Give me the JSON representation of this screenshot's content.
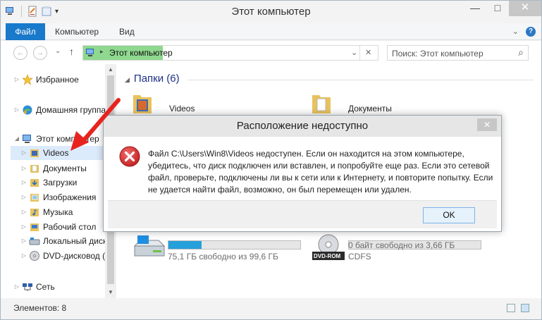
{
  "window": {
    "title": "Этот компьютер",
    "controls": {
      "minimize": "—",
      "maximize": "□",
      "close": "✕"
    }
  },
  "ribbon": {
    "tabs": [
      "Файл",
      "Компьютер",
      "Вид"
    ],
    "collapse_glyph": "⌄",
    "help_glyph": "?"
  },
  "navigation": {
    "back_glyph": "←",
    "forward_glyph": "→",
    "recent_glyph": "⌄",
    "up_glyph": "↑",
    "address_path": "Этот компьютер",
    "address_sep": "▸",
    "address_dropdown_glyph": "⌄",
    "address_clear_glyph": "✕",
    "search_placeholder": "Поиск: Этот компьютер",
    "search_icon_glyph": "⌕"
  },
  "nav_pane": {
    "items": [
      {
        "label": "Избранное",
        "icon": "star-icon"
      },
      {
        "label": "Домашняя группа",
        "icon": "homegroup-icon"
      },
      {
        "label": "Этот компьютер",
        "icon": "computer-icon"
      },
      {
        "label": "Videos",
        "icon": "videos-folder-icon"
      },
      {
        "label": "Документы",
        "icon": "documents-folder-icon"
      },
      {
        "label": "Загрузки",
        "icon": "downloads-folder-icon"
      },
      {
        "label": "Изображения",
        "icon": "pictures-folder-icon"
      },
      {
        "label": "Музыка",
        "icon": "music-folder-icon"
      },
      {
        "label": "Рабочий стол",
        "icon": "desktop-folder-icon"
      },
      {
        "label": "Локальный диск",
        "icon": "local-disk-icon"
      },
      {
        "label": "DVD-дисковод (E",
        "icon": "dvd-drive-icon"
      },
      {
        "label": "Сеть",
        "icon": "network-icon"
      }
    ]
  },
  "content": {
    "group_title": "Папки (6)",
    "folders": [
      {
        "name": "Videos",
        "icon": "videos-folder-icon"
      },
      {
        "name": "Документы",
        "icon": "documents-folder-icon"
      }
    ],
    "drives": [
      {
        "free_text": "75,1 ГБ свободно из 99,6 ГБ",
        "used_fraction": 0.25,
        "icon": "local-disk-icon"
      },
      {
        "free_text": "0 байт свободно из 3,66 ГБ",
        "fs_text": "CDFS",
        "used_fraction": 1.0,
        "icon": "dvd-rom-icon",
        "badge": "DVD-ROM"
      }
    ]
  },
  "status_bar": {
    "items_count": "Элементов: 8"
  },
  "dialog": {
    "title": "Расположение недоступно",
    "message": "Файл C:\\Users\\Win8\\Videos недоступен. Если он находится на этом компьютере, убедитесь, что диск подключен или вставлен, и попробуйте еще раз. Если это сетевой файл, проверьте, подключены ли вы к сети или к Интернету, и повторите попытку. Если не удается найти файл, возможно, он был перемещен или удален.",
    "ok_label": "OK",
    "close_glyph": "✕"
  },
  "colors": {
    "file_tab": "#1979ca",
    "selection": "#dcebfc",
    "address_highlight": "#8fd88f",
    "error_red": "#d9302c",
    "arrow_red": "#e8231e",
    "progress": "#26a0da"
  }
}
